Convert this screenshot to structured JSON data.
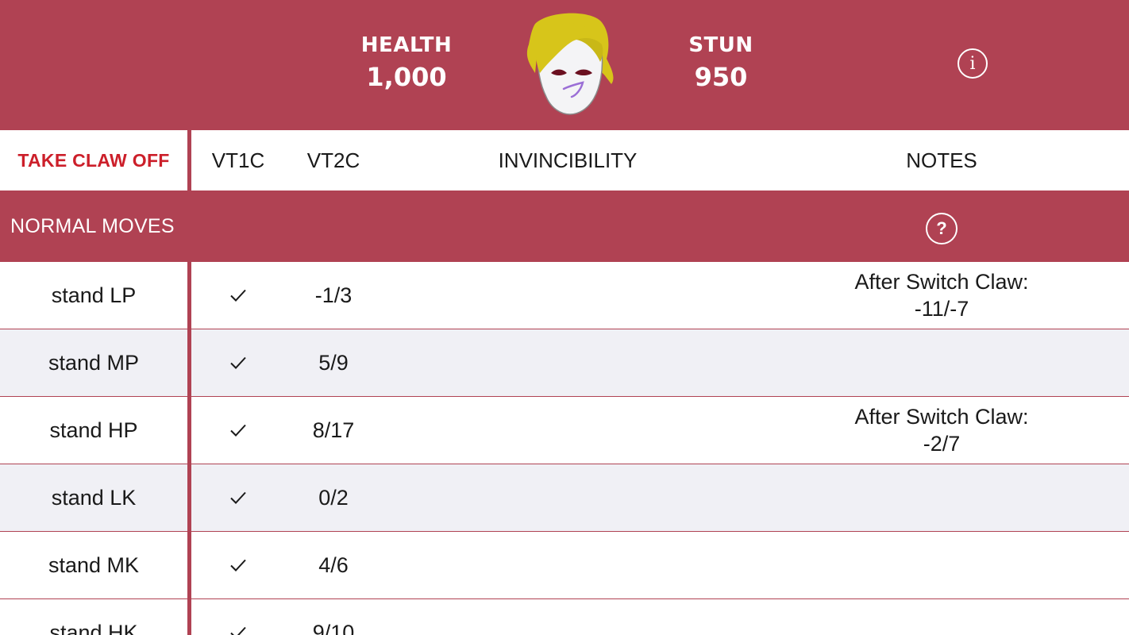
{
  "header": {
    "health_label": "HEALTH",
    "health_value": "1,000",
    "stun_label": "STUN",
    "stun_value": "950",
    "info_icon": "i",
    "colors": {
      "accent": "#b04253",
      "claw_text": "#cc1f2a",
      "row_alt": "#f0f0f5"
    }
  },
  "columns": {
    "claw_toggle": "TAKE CLAW OFF",
    "vt1": "VT1C",
    "vt2": "VT2C",
    "invincibility": "INVINCIBILITY",
    "notes": "NOTES"
  },
  "section": {
    "title": "NORMAL MOVES",
    "help_icon": "?"
  },
  "rows": [
    {
      "move": "stand LP",
      "vt1": "check-icon",
      "vt2": "-1/3",
      "invincibility": "",
      "notes": "After Switch Claw:\n-11/-7"
    },
    {
      "move": "stand MP",
      "vt1": "check-icon",
      "vt2": "5/9",
      "invincibility": "",
      "notes": ""
    },
    {
      "move": "stand HP",
      "vt1": "check-icon",
      "vt2": "8/17",
      "invincibility": "",
      "notes": "After Switch Claw:\n-2/7"
    },
    {
      "move": "stand LK",
      "vt1": "check-icon",
      "vt2": "0/2",
      "invincibility": "",
      "notes": ""
    },
    {
      "move": "stand MK",
      "vt1": "check-icon",
      "vt2": "4/6",
      "invincibility": "",
      "notes": ""
    },
    {
      "move": "stand HK",
      "vt1": "check-icon",
      "vt2": "9/10",
      "invincibility": "",
      "notes": ""
    }
  ]
}
